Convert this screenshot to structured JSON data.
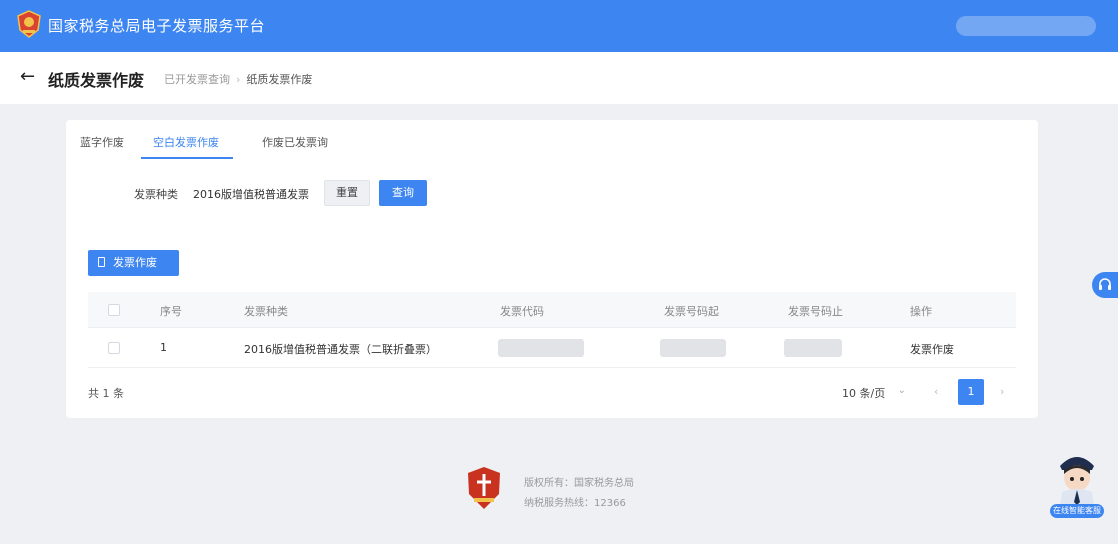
{
  "header": {
    "app_title": "国家税务总局电子发票服务平台",
    "accent_color": "#3d85f0"
  },
  "page": {
    "title": "纸质发票作废",
    "breadcrumbs": [
      "已开发票查询",
      "纸质发票作废"
    ]
  },
  "tabs": [
    {
      "label": "蓝字作废",
      "active": false
    },
    {
      "label": "空白发票作废",
      "active": true
    },
    {
      "label": "作废已发票询",
      "active": false
    }
  ],
  "filter": {
    "label": "发票种类",
    "selected": "2016版增值税普通发票",
    "reset_label": "重置",
    "query_label": "查询"
  },
  "actions": {
    "void_label": "发票作废"
  },
  "table": {
    "columns": [
      "序号",
      "发票种类",
      "发票代码",
      "发票号码起",
      "发票号码止",
      "操作"
    ],
    "rows": [
      {
        "index": "1",
        "type": "2016版增值税普通发票（二联折叠票）",
        "action": "发票作废"
      }
    ]
  },
  "pagination": {
    "total": "共 1 条",
    "page_size": "10 条/页",
    "current_page": "1",
    "prev": "‹",
    "next": "›"
  },
  "footer": {
    "line1": "版权所有：国家税务总局",
    "line2": "纳税服务热线：12366"
  },
  "assistant": {
    "label": "在线智能客服"
  }
}
